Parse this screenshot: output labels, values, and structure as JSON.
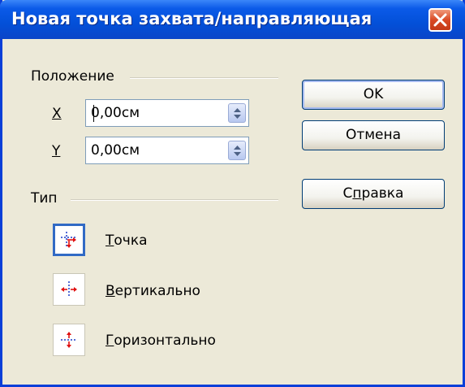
{
  "window": {
    "title": "Новая точка захвата/направляющая"
  },
  "position_group": {
    "label": "Положение",
    "x": {
      "label": "X",
      "value": "0,00см"
    },
    "y": {
      "label": "Y",
      "value": "0,00см"
    }
  },
  "buttons": {
    "ok": "OK",
    "cancel": "Отмена",
    "help_before": "С",
    "help_mnemonic": "п",
    "help_after": "равка"
  },
  "type_group": {
    "label": "Тип",
    "options": [
      {
        "mnemonic": "Т",
        "rest": "очка",
        "selected": true,
        "icon": "snap-point-icon"
      },
      {
        "mnemonic": "В",
        "rest": "ертикально",
        "selected": false,
        "icon": "snap-vertical-icon"
      },
      {
        "mnemonic": "Г",
        "rest": "оризонтально",
        "selected": false,
        "icon": "snap-horizontal-icon"
      }
    ]
  },
  "colors": {
    "titlebar": "#0350d8",
    "dialog_bg": "#ece9d8",
    "close_button": "#d94a25",
    "icon_red": "#e01010",
    "icon_blue": "#1a3cc8"
  }
}
